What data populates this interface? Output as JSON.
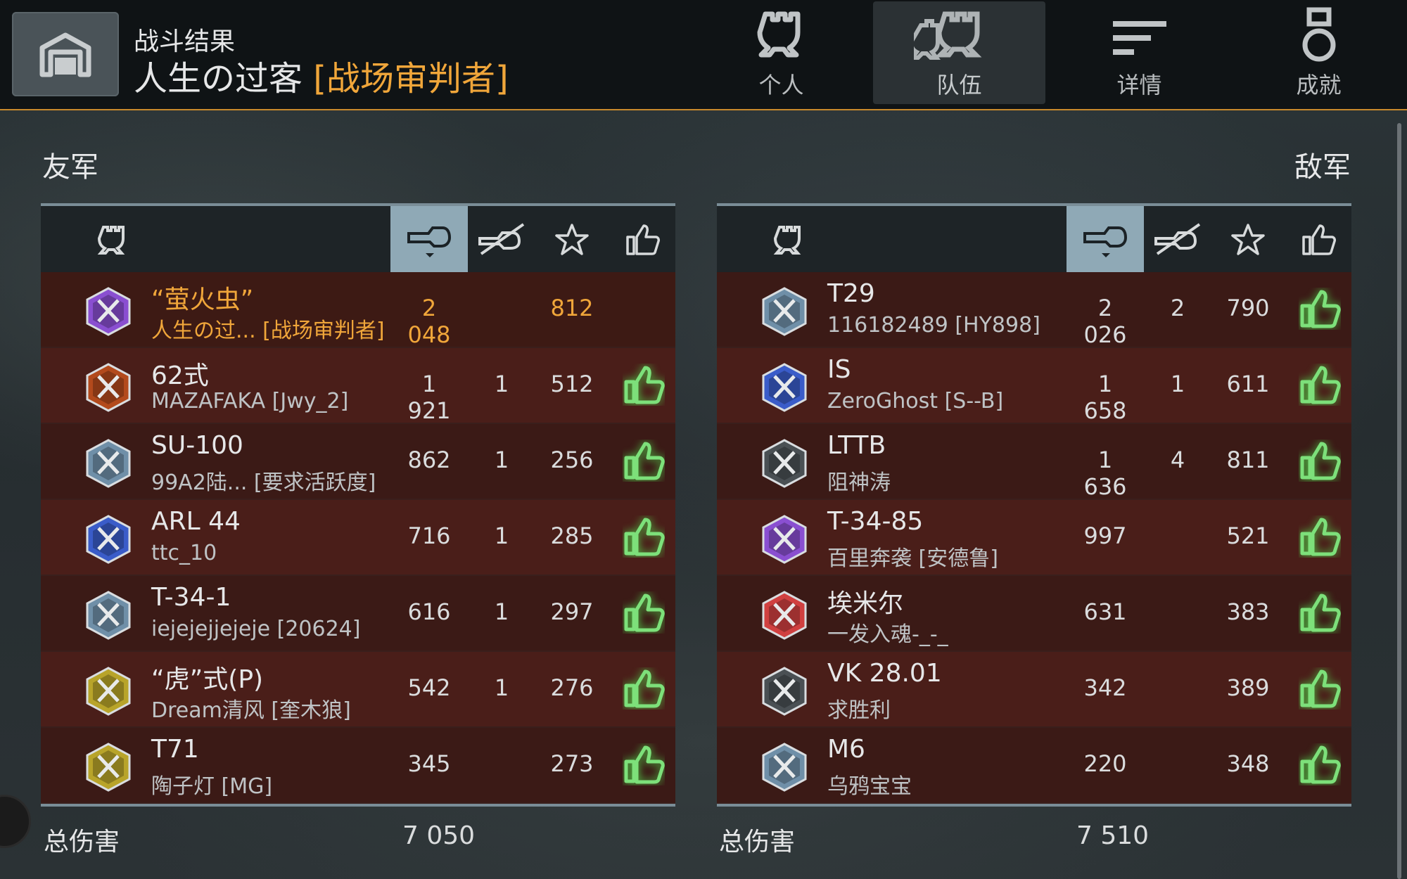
{
  "header": {
    "subtitle": "战斗结果",
    "player_name": "人生の过客",
    "clan_tag": "[战场审判者]",
    "home_icon": "garage-icon",
    "tabs": [
      {
        "label": "个人",
        "icon": "helmet-icon",
        "active": false
      },
      {
        "label": "队伍",
        "icon": "team-helmets-icon",
        "active": true
      },
      {
        "label": "详情",
        "icon": "list-lines-icon",
        "active": false
      },
      {
        "label": "成就",
        "icon": "medal-icon",
        "active": false
      }
    ]
  },
  "colors": {
    "accent": "#f0a63a",
    "thumb_green": "#7de07a",
    "selected_header": "#8fa9b6",
    "row_red": "#4a1e19"
  },
  "allies": {
    "title": "友军",
    "columns": [
      "tank-helmet-icon",
      "damage-icon",
      "kills-icon",
      "star-icon",
      "thumb-up-icon"
    ],
    "rows": [
      {
        "tank": "“萤火虫”",
        "player": "人生の过... [战场审判者]",
        "damage": "2 048",
        "kills": "",
        "score": "812",
        "thumb": false,
        "self": true
      },
      {
        "tank": "62式",
        "player": "MAZAFAKA [Jwy_2]",
        "damage": "1 921",
        "kills": "1",
        "score": "512",
        "thumb": true
      },
      {
        "tank": "SU-100",
        "player": "99A2陆...   [要求活跃度]",
        "damage": "862",
        "kills": "1",
        "score": "256",
        "thumb": true
      },
      {
        "tank": "ARL 44",
        "player": "ttc_10",
        "damage": "716",
        "kills": "1",
        "score": "285",
        "thumb": true
      },
      {
        "tank": "T-34-1",
        "player": "iejejejjejeje [20624]",
        "damage": "616",
        "kills": "1",
        "score": "297",
        "thumb": true
      },
      {
        "tank": "“虎”式(P)",
        "player": "Dream清风 [奎木狼]",
        "damage": "542",
        "kills": "1",
        "score": "276",
        "thumb": true
      },
      {
        "tank": "T71",
        "player": "陶子灯 [MG]",
        "damage": "345",
        "kills": "",
        "score": "273",
        "thumb": true
      }
    ],
    "total_label": "总伤害",
    "total_damage": "7 050"
  },
  "enemies": {
    "title": "敌军",
    "columns": [
      "tank-helmet-icon",
      "damage-icon",
      "kills-icon",
      "star-icon",
      "thumb-up-icon"
    ],
    "rows": [
      {
        "tank": "T29",
        "player": "116182489 [HY898]",
        "damage": "2 026",
        "kills": "2",
        "score": "790",
        "thumb": true
      },
      {
        "tank": "IS",
        "player": "ZeroGhost [S--B]",
        "damage": "1 658",
        "kills": "1",
        "score": "611",
        "thumb": true
      },
      {
        "tank": "LTTB",
        "player": "阻神涛",
        "damage": "1 636",
        "kills": "4",
        "score": "811",
        "thumb": true
      },
      {
        "tank": "T-34-85",
        "player": "百里奔袭 [安德鲁]",
        "damage": "997",
        "kills": "",
        "score": "521",
        "thumb": true
      },
      {
        "tank": "埃米尔",
        "player": "一发入魂-_-_",
        "damage": "631",
        "kills": "",
        "score": "383",
        "thumb": true
      },
      {
        "tank": "VK 28.01",
        "player": "求胜利",
        "damage": "342",
        "kills": "",
        "score": "389",
        "thumb": true
      },
      {
        "tank": "M6",
        "player": "乌鸦宝宝",
        "damage": "220",
        "kills": "",
        "score": "348",
        "thumb": true
      }
    ],
    "total_label": "总伤害",
    "total_damage": "7 510"
  }
}
